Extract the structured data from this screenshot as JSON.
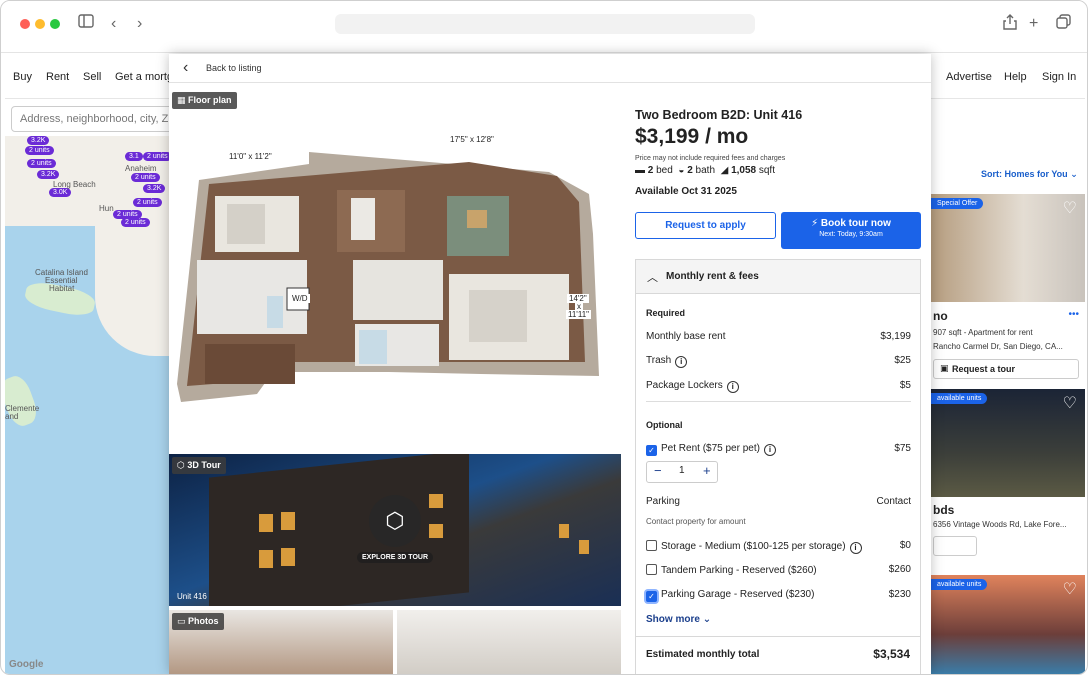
{
  "browser": {
    "icons": [
      "sidebar-icon",
      "back-arrow-icon",
      "forward-arrow-icon",
      "share-icon",
      "new-tab-icon",
      "tabs-icon"
    ]
  },
  "site_nav": {
    "left_items": [
      "Buy",
      "Rent",
      "Sell",
      "Get a mortga"
    ],
    "right_items": [
      "Advertise",
      "Help",
      "Sign In"
    ],
    "search_placeholder": "Address, neighborhood, city, ZIP"
  },
  "map": {
    "pins": [
      "3.2K",
      "2 units",
      "2 units",
      "3.2K",
      "3.1",
      "2 units",
      "2 units",
      "3.0K",
      "2 units",
      "2 units",
      "2 units",
      "2 units",
      "3.2K",
      "3.2K"
    ],
    "labels": [
      "Long Beach",
      "Anaheim",
      "Hun",
      "Catalina Island",
      "Essential",
      "Habitat",
      "Clemente",
      "and"
    ],
    "attribution": "Google"
  },
  "results": {
    "sort_label": "Sort: Homes for You",
    "cards": [
      {
        "badge": "Special Offer",
        "title": "no",
        "sub1": "907 sqft - Apartment for rent",
        "sub2": "Rancho Carmel Dr, San Diego, CA...",
        "button": "Request a tour"
      },
      {
        "badge": "available units",
        "title": "bds",
        "sub1": "6356 Vintage Woods Rd, Lake Fore..."
      },
      {
        "badge": "available units"
      }
    ]
  },
  "modal": {
    "back_label": "Back to listing",
    "floor_plan_tag": "Floor plan",
    "dimensions": [
      "17'5\" x 12'8\"",
      "11'0\" x 11'2\"",
      "14'2\"",
      "x",
      "11'11\"",
      "W/D"
    ],
    "tour_tag": "3D Tour",
    "tour_cta": "EXPLORE 3D TOUR",
    "unit_label": "Unit 416",
    "photos_tag": "Photos",
    "title": "Two Bedroom B2D: Unit 416",
    "price": "$3,199 / mo",
    "price_note": "Price may not include required fees and charges",
    "beds_num": "2",
    "beds_label": "bed",
    "baths_num": "2",
    "baths_label": "bath",
    "sqft_num": "1,058",
    "sqft_label": "sqft",
    "available": "Available Oct 31 2025",
    "apply_button": "Request to apply",
    "tour_button": "Book tour now",
    "tour_button_sub": "Next: Today, 9:30am",
    "fees": {
      "header": "Monthly rent & fees",
      "required_label": "Required",
      "required": [
        {
          "label": "Monthly base rent",
          "value": "$3,199"
        },
        {
          "label": "Trash",
          "value": "$25"
        },
        {
          "label": "Package Lockers",
          "value": "$5"
        }
      ],
      "optional_label": "Optional",
      "pet_rent": {
        "label": "Pet Rent ($75 per pet)",
        "value": "$75",
        "checked": true,
        "qty": "1"
      },
      "parking": {
        "label": "Parking",
        "value": "Contact",
        "note": "Contact property for amount"
      },
      "options": [
        {
          "label": "Storage - Medium ($100-125 per storage)",
          "value": "$0",
          "checked": false
        },
        {
          "label": "Tandem Parking - Reserved ($260)",
          "value": "$260",
          "checked": false
        },
        {
          "label": "Parking Garage - Reserved ($230)",
          "value": "$230",
          "checked": true
        }
      ],
      "show_more": "Show more",
      "total_label": "Estimated monthly total",
      "total_value": "$3,534"
    }
  }
}
